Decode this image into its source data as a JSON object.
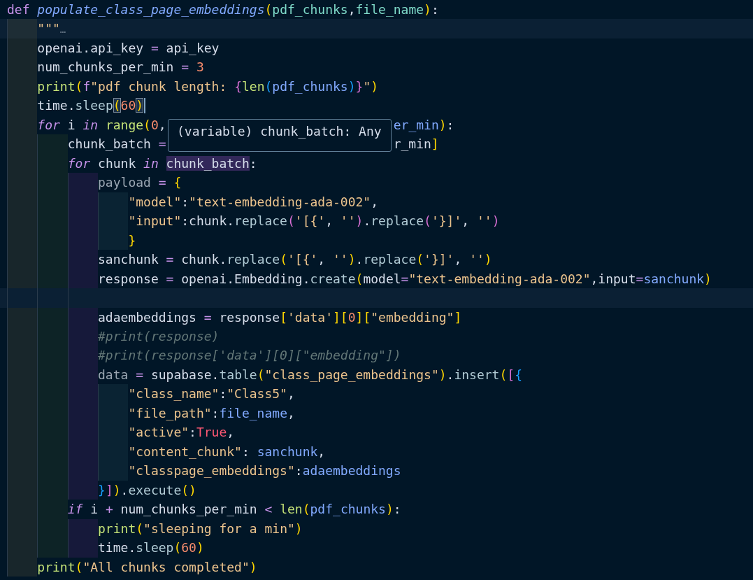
{
  "editor": {
    "tooltip": "(variable) chunk_batch: Any",
    "lines": [
      {
        "current": false,
        "tokens": [
          {
            "text": "def ",
            "kind": "kw"
          },
          {
            "text": "populate_class_page_embeddings",
            "kind": "fn"
          },
          {
            "text": "(",
            "kind": "b1"
          },
          {
            "text": "pdf_chunks",
            "kind": "param"
          },
          {
            "text": ",",
            "kind": "punct"
          },
          {
            "text": "file_name",
            "kind": "param"
          },
          {
            "text": ")",
            "kind": "b1"
          },
          {
            "text": ":",
            "kind": "punct"
          }
        ],
        "children": [
          {
            "current": true,
            "tokens": [
              {
                "text": "\"\"\"",
                "kind": "str"
              },
              {
                "text": "…",
                "kind": "fold"
              }
            ]
          },
          {
            "current": false,
            "tokens": [
              {
                "text": "openai.api_key ",
                "kind": "var"
              },
              {
                "text": "=",
                "kind": "op"
              },
              {
                "text": " api_key",
                "kind": "var"
              }
            ]
          },
          {
            "current": false,
            "tokens": [
              {
                "text": "num_chunks_per_min ",
                "kind": "var"
              },
              {
                "text": "=",
                "kind": "op"
              },
              {
                "text": " 3",
                "kind": "num"
              }
            ]
          },
          {
            "current": false,
            "tokens": [
              {
                "text": "print",
                "kind": "builtin"
              },
              {
                "text": "(",
                "kind": "b1"
              },
              {
                "text": "f",
                "kind": "kw"
              },
              {
                "text": "\"pdf chunk length: ",
                "kind": "str"
              },
              {
                "text": "{",
                "kind": "b2"
              },
              {
                "text": "len",
                "kind": "builtin"
              },
              {
                "text": "(",
                "kind": "b3"
              },
              {
                "text": "pdf_chunks",
                "kind": "ref"
              },
              {
                "text": ")",
                "kind": "b3"
              },
              {
                "text": "}",
                "kind": "b2"
              },
              {
                "text": "\"",
                "kind": "str"
              },
              {
                "text": ")",
                "kind": "b1"
              }
            ]
          },
          {
            "current": false,
            "cursor": true,
            "tokens": [
              {
                "text": "time.",
                "kind": "var"
              },
              {
                "text": "sleep",
                "kind": "method"
              },
              {
                "text": "(",
                "kind": "b1",
                "matched": true
              },
              {
                "text": "60",
                "kind": "num"
              },
              {
                "text": ")",
                "kind": "b1",
                "matched": true
              }
            ]
          },
          {
            "current": false,
            "tokens": [
              {
                "text": "for",
                "kind": "ctrl"
              },
              {
                "text": " i ",
                "kind": "var"
              },
              {
                "text": "in ",
                "kind": "ctrl"
              },
              {
                "text": "range",
                "kind": "builtin"
              },
              {
                "text": "(",
                "kind": "b1"
              },
              {
                "text": "0",
                "kind": "num"
              },
              {
                "text": ",",
                "kind": "punct"
              }
            ],
            "after_tooltip": [
              {
                "text": "er_min",
                "kind": "ref"
              },
              {
                "text": ")",
                "kind": "b1"
              },
              {
                "text": ":",
                "kind": "punct"
              }
            ],
            "children": [
              {
                "current": false,
                "tokens": [
                  {
                    "text": "chunk_batch ",
                    "kind": "var"
                  },
                  {
                    "text": "=",
                    "kind": "op"
                  }
                ],
                "after_tooltip": [
                  {
                    "text": "r_min",
                    "kind": "var"
                  },
                  {
                    "text": "]",
                    "kind": "b1"
                  }
                ]
              },
              {
                "current": false,
                "tokens": [
                  {
                    "text": "for",
                    "kind": "ctrl"
                  },
                  {
                    "text": " chunk ",
                    "kind": "var"
                  },
                  {
                    "text": "in ",
                    "kind": "ctrl"
                  },
                  {
                    "text": "chunk_batch",
                    "kind": "var",
                    "highlighted": true
                  },
                  {
                    "text": ":",
                    "kind": "punct"
                  }
                ],
                "children": [
                  {
                    "current": false,
                    "tokens": [
                      {
                        "text": "payload",
                        "kind": "dim"
                      },
                      {
                        "text": " = ",
                        "kind": "op"
                      },
                      {
                        "text": "{",
                        "kind": "b1"
                      }
                    ],
                    "children": [
                      {
                        "current": false,
                        "tokens": [
                          {
                            "text": "\"model\"",
                            "kind": "str"
                          },
                          {
                            "text": ":",
                            "kind": "punct"
                          },
                          {
                            "text": "\"text-embedding-ada-002\"",
                            "kind": "str"
                          },
                          {
                            "text": ",",
                            "kind": "punct"
                          }
                        ]
                      },
                      {
                        "current": false,
                        "tokens": [
                          {
                            "text": "\"input\"",
                            "kind": "str"
                          },
                          {
                            "text": ":chunk.",
                            "kind": "var"
                          },
                          {
                            "text": "replace",
                            "kind": "method"
                          },
                          {
                            "text": "(",
                            "kind": "b2"
                          },
                          {
                            "text": "'[{'",
                            "kind": "str"
                          },
                          {
                            "text": ", ",
                            "kind": "punct"
                          },
                          {
                            "text": "''",
                            "kind": "str"
                          },
                          {
                            "text": ")",
                            "kind": "b2"
                          },
                          {
                            "text": ".",
                            "kind": "punct"
                          },
                          {
                            "text": "replace",
                            "kind": "method"
                          },
                          {
                            "text": "(",
                            "kind": "b2"
                          },
                          {
                            "text": "'}]'",
                            "kind": "str"
                          },
                          {
                            "text": ", ",
                            "kind": "punct"
                          },
                          {
                            "text": "''",
                            "kind": "str"
                          },
                          {
                            "text": ")",
                            "kind": "b2"
                          }
                        ]
                      },
                      {
                        "current": false,
                        "tokens": [
                          {
                            "text": "}",
                            "kind": "b1"
                          }
                        ]
                      }
                    ]
                  },
                  {
                    "current": false,
                    "tokens": [
                      {
                        "text": "sanchunk ",
                        "kind": "var"
                      },
                      {
                        "text": "=",
                        "kind": "op"
                      },
                      {
                        "text": " chunk.",
                        "kind": "var"
                      },
                      {
                        "text": "replace",
                        "kind": "method"
                      },
                      {
                        "text": "(",
                        "kind": "b1"
                      },
                      {
                        "text": "'[{'",
                        "kind": "str"
                      },
                      {
                        "text": ", ",
                        "kind": "punct"
                      },
                      {
                        "text": "''",
                        "kind": "str"
                      },
                      {
                        "text": ")",
                        "kind": "b1"
                      },
                      {
                        "text": ".",
                        "kind": "punct"
                      },
                      {
                        "text": "replace",
                        "kind": "method"
                      },
                      {
                        "text": "(",
                        "kind": "b1"
                      },
                      {
                        "text": "'}]'",
                        "kind": "str"
                      },
                      {
                        "text": ", ",
                        "kind": "punct"
                      },
                      {
                        "text": "''",
                        "kind": "str"
                      },
                      {
                        "text": ")",
                        "kind": "b1"
                      }
                    ]
                  },
                  {
                    "current": false,
                    "tokens": [
                      {
                        "text": "response ",
                        "kind": "var"
                      },
                      {
                        "text": "=",
                        "kind": "op"
                      },
                      {
                        "text": " openai.Embedding.",
                        "kind": "var"
                      },
                      {
                        "text": "create",
                        "kind": "method"
                      },
                      {
                        "text": "(",
                        "kind": "b1"
                      },
                      {
                        "text": "model",
                        "kind": "var"
                      },
                      {
                        "text": "=",
                        "kind": "op"
                      },
                      {
                        "text": "\"text-embedding-ada-002\"",
                        "kind": "str"
                      },
                      {
                        "text": ",input",
                        "kind": "var"
                      },
                      {
                        "text": "=",
                        "kind": "op"
                      },
                      {
                        "text": "sanchunk",
                        "kind": "ref"
                      },
                      {
                        "text": ")",
                        "kind": "b1"
                      }
                    ]
                  },
                  {
                    "current": true
                  },
                  {
                    "current": false,
                    "tokens": [
                      {
                        "text": "adaembeddings ",
                        "kind": "var"
                      },
                      {
                        "text": "=",
                        "kind": "op"
                      },
                      {
                        "text": " response",
                        "kind": "var"
                      },
                      {
                        "text": "[",
                        "kind": "b1"
                      },
                      {
                        "text": "'data'",
                        "kind": "str"
                      },
                      {
                        "text": "]",
                        "kind": "b1"
                      },
                      {
                        "text": "[",
                        "kind": "b1"
                      },
                      {
                        "text": "0",
                        "kind": "num"
                      },
                      {
                        "text": "]",
                        "kind": "b1"
                      },
                      {
                        "text": "[",
                        "kind": "b1"
                      },
                      {
                        "text": "\"embedding\"",
                        "kind": "str"
                      },
                      {
                        "text": "]",
                        "kind": "b1"
                      }
                    ]
                  },
                  {
                    "current": false,
                    "tokens": [
                      {
                        "text": "#print(response)",
                        "kind": "comment"
                      }
                    ]
                  },
                  {
                    "current": false,
                    "tokens": [
                      {
                        "text": "#print(response['data'][0][\"embedding\"])",
                        "kind": "comment"
                      }
                    ]
                  },
                  {
                    "current": false,
                    "tokens": [
                      {
                        "text": "data",
                        "kind": "dim"
                      },
                      {
                        "text": " = ",
                        "kind": "op"
                      },
                      {
                        "text": "supabase.",
                        "kind": "var"
                      },
                      {
                        "text": "table",
                        "kind": "method"
                      },
                      {
                        "text": "(",
                        "kind": "b1"
                      },
                      {
                        "text": "\"class_page_embeddings\"",
                        "kind": "str"
                      },
                      {
                        "text": ")",
                        "kind": "b1"
                      },
                      {
                        "text": ".",
                        "kind": "punct"
                      },
                      {
                        "text": "insert",
                        "kind": "method"
                      },
                      {
                        "text": "(",
                        "kind": "b1"
                      },
                      {
                        "text": "[",
                        "kind": "b2"
                      },
                      {
                        "text": "{",
                        "kind": "b3"
                      }
                    ],
                    "children": [
                      {
                        "current": false,
                        "tokens": [
                          {
                            "text": "\"class_name\"",
                            "kind": "str"
                          },
                          {
                            "text": ":",
                            "kind": "punct"
                          },
                          {
                            "text": "\"Class5\"",
                            "kind": "str"
                          },
                          {
                            "text": ",",
                            "kind": "punct"
                          }
                        ]
                      },
                      {
                        "current": false,
                        "tokens": [
                          {
                            "text": "\"file_path\"",
                            "kind": "str"
                          },
                          {
                            "text": ":",
                            "kind": "punct"
                          },
                          {
                            "text": "file_name",
                            "kind": "ref"
                          },
                          {
                            "text": ",",
                            "kind": "punct"
                          }
                        ]
                      },
                      {
                        "current": false,
                        "tokens": [
                          {
                            "text": "\"active\"",
                            "kind": "str"
                          },
                          {
                            "text": ":",
                            "kind": "punct"
                          },
                          {
                            "text": "True",
                            "kind": "bool"
                          },
                          {
                            "text": ",",
                            "kind": "punct"
                          }
                        ]
                      },
                      {
                        "current": false,
                        "tokens": [
                          {
                            "text": "\"content_chunk\"",
                            "kind": "str"
                          },
                          {
                            "text": ": ",
                            "kind": "punct"
                          },
                          {
                            "text": "sanchunk",
                            "kind": "ref"
                          },
                          {
                            "text": ",",
                            "kind": "punct"
                          }
                        ]
                      },
                      {
                        "current": false,
                        "tokens": [
                          {
                            "text": "\"classpage_embeddings\"",
                            "kind": "str"
                          },
                          {
                            "text": ":",
                            "kind": "punct"
                          },
                          {
                            "text": "adaembeddings",
                            "kind": "ref"
                          }
                        ]
                      }
                    ]
                  },
                  {
                    "current": false,
                    "tokens": [
                      {
                        "text": "}",
                        "kind": "b3"
                      },
                      {
                        "text": "]",
                        "kind": "b2"
                      },
                      {
                        "text": ")",
                        "kind": "b1"
                      },
                      {
                        "text": ".",
                        "kind": "punct"
                      },
                      {
                        "text": "execute",
                        "kind": "method"
                      },
                      {
                        "text": "(",
                        "kind": "b1"
                      },
                      {
                        "text": ")",
                        "kind": "b1"
                      }
                    ]
                  }
                ]
              },
              {
                "current": false,
                "tokens": [
                  {
                    "text": "if",
                    "kind": "ctrl"
                  },
                  {
                    "text": " i ",
                    "kind": "var"
                  },
                  {
                    "text": "+",
                    "kind": "op"
                  },
                  {
                    "text": " num_chunks_per_min ",
                    "kind": "var"
                  },
                  {
                    "text": "<",
                    "kind": "op"
                  },
                  {
                    "text": " len",
                    "kind": "builtin"
                  },
                  {
                    "text": "(",
                    "kind": "b1"
                  },
                  {
                    "text": "pdf_chunks",
                    "kind": "ref"
                  },
                  {
                    "text": ")",
                    "kind": "b1"
                  },
                  {
                    "text": ":",
                    "kind": "punct"
                  }
                ],
                "children": [
                  {
                    "current": false,
                    "tokens": [
                      {
                        "text": "print",
                        "kind": "builtin"
                      },
                      {
                        "text": "(",
                        "kind": "b1"
                      },
                      {
                        "text": "\"sleeping for a min\"",
                        "kind": "str"
                      },
                      {
                        "text": ")",
                        "kind": "b1"
                      }
                    ]
                  },
                  {
                    "current": false,
                    "tokens": [
                      {
                        "text": "time.",
                        "kind": "var"
                      },
                      {
                        "text": "sleep",
                        "kind": "method"
                      },
                      {
                        "text": "(",
                        "kind": "b1"
                      },
                      {
                        "text": "60",
                        "kind": "num"
                      },
                      {
                        "text": ")",
                        "kind": "b1"
                      }
                    ]
                  }
                ]
              }
            ]
          },
          {
            "current": false,
            "tokens": [
              {
                "text": "print",
                "kind": "builtin"
              },
              {
                "text": "(",
                "kind": "b1"
              },
              {
                "text": "\"All chunks completed\"",
                "kind": "str"
              },
              {
                "text": ")",
                "kind": "b1"
              }
            ]
          }
        ]
      }
    ]
  }
}
